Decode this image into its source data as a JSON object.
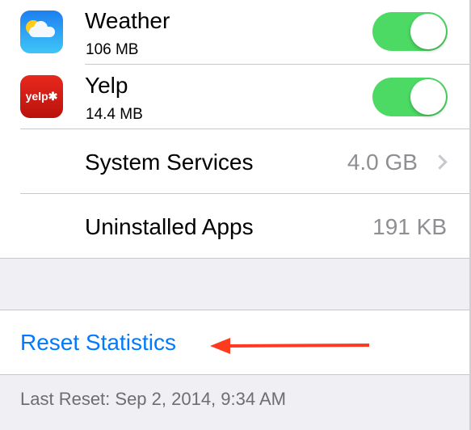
{
  "apps": [
    {
      "name": "Weather",
      "size": "106 MB",
      "icon": "weather-icon",
      "enabled": true
    },
    {
      "name": "Yelp",
      "size": "14.4 MB",
      "icon": "yelp-icon",
      "icon_text": "yelp",
      "enabled": true
    }
  ],
  "system_services": {
    "label": "System Services",
    "value": "4.0 GB"
  },
  "uninstalled_apps": {
    "label": "Uninstalled Apps",
    "value": "191 KB"
  },
  "reset": {
    "label": "Reset Statistics"
  },
  "last_reset": "Last Reset: Sep 2, 2014, 9:34 AM",
  "colors": {
    "toggle_on": "#4cd964",
    "link": "#007aff",
    "arrow": "#ff3b1f"
  }
}
